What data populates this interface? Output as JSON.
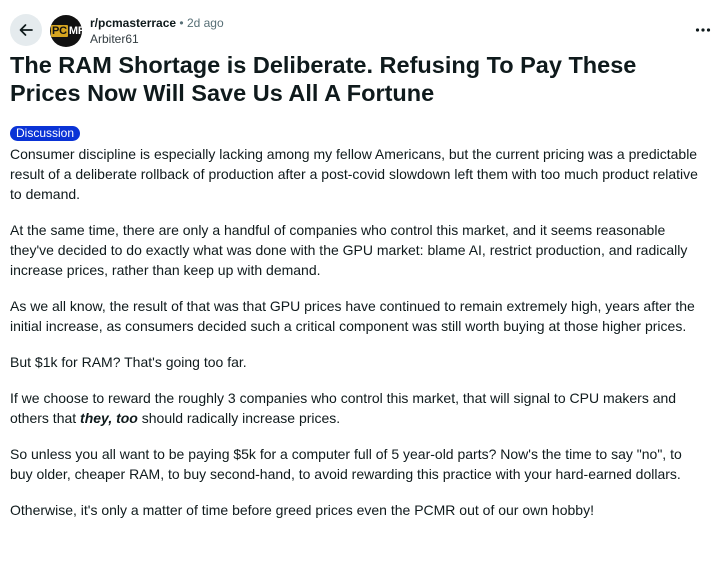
{
  "header": {
    "back_icon": "arrow-left-icon",
    "avatar": {
      "logo_text_a": "PC",
      "logo_text_b": "MR",
      "colors": {
        "background": "#111111",
        "accent": "#d6a520"
      }
    },
    "subreddit": "r/pcmasterrace",
    "separator": "•",
    "time_ago": "2d ago",
    "author": "Arbiter61",
    "more_icon": "more-horizontal-icon"
  },
  "post": {
    "title": "The RAM Shortage is Deliberate. Refusing To Pay These Prices Now Will Save Us All A Fortune",
    "flair": {
      "label": "Discussion",
      "color": "#0a33d6"
    },
    "paragraphs": [
      "Consumer discipline is especially lacking among my fellow Americans, but the current pricing was a predictable result of a deliberate rollback of production after a post-covid slowdown left them with too much product relative to demand.",
      "At the same time, there are only a handful of companies who control this market, and it seems reasonable they've decided to do exactly what was done with the GPU market: blame AI, restrict production, and radically increase prices, rather than keep up with demand.",
      "As we all know, the result of that was that GPU prices have continued to remain extremely high, years after the initial increase, as consumers decided such a critical component was still worth buying at those higher prices.",
      "But $1k for RAM? That's going too far."
    ],
    "paragraph5": {
      "before": "If we choose to reward the roughly 3 companies who control this market, that will signal to CPU makers and others that ",
      "emphasis": "they, too",
      "after": " should radically increase prices."
    },
    "paragraphs_end": [
      "So unless you all want to be paying $5k for a computer full of 5 year-old parts? Now's the time to say \"no\", to buy older, cheaper RAM, to buy second-hand, to avoid rewarding this practice with your hard-earned dollars.",
      "Otherwise, it's only a matter of time before greed prices even the PCMR out of our own hobby!"
    ]
  }
}
